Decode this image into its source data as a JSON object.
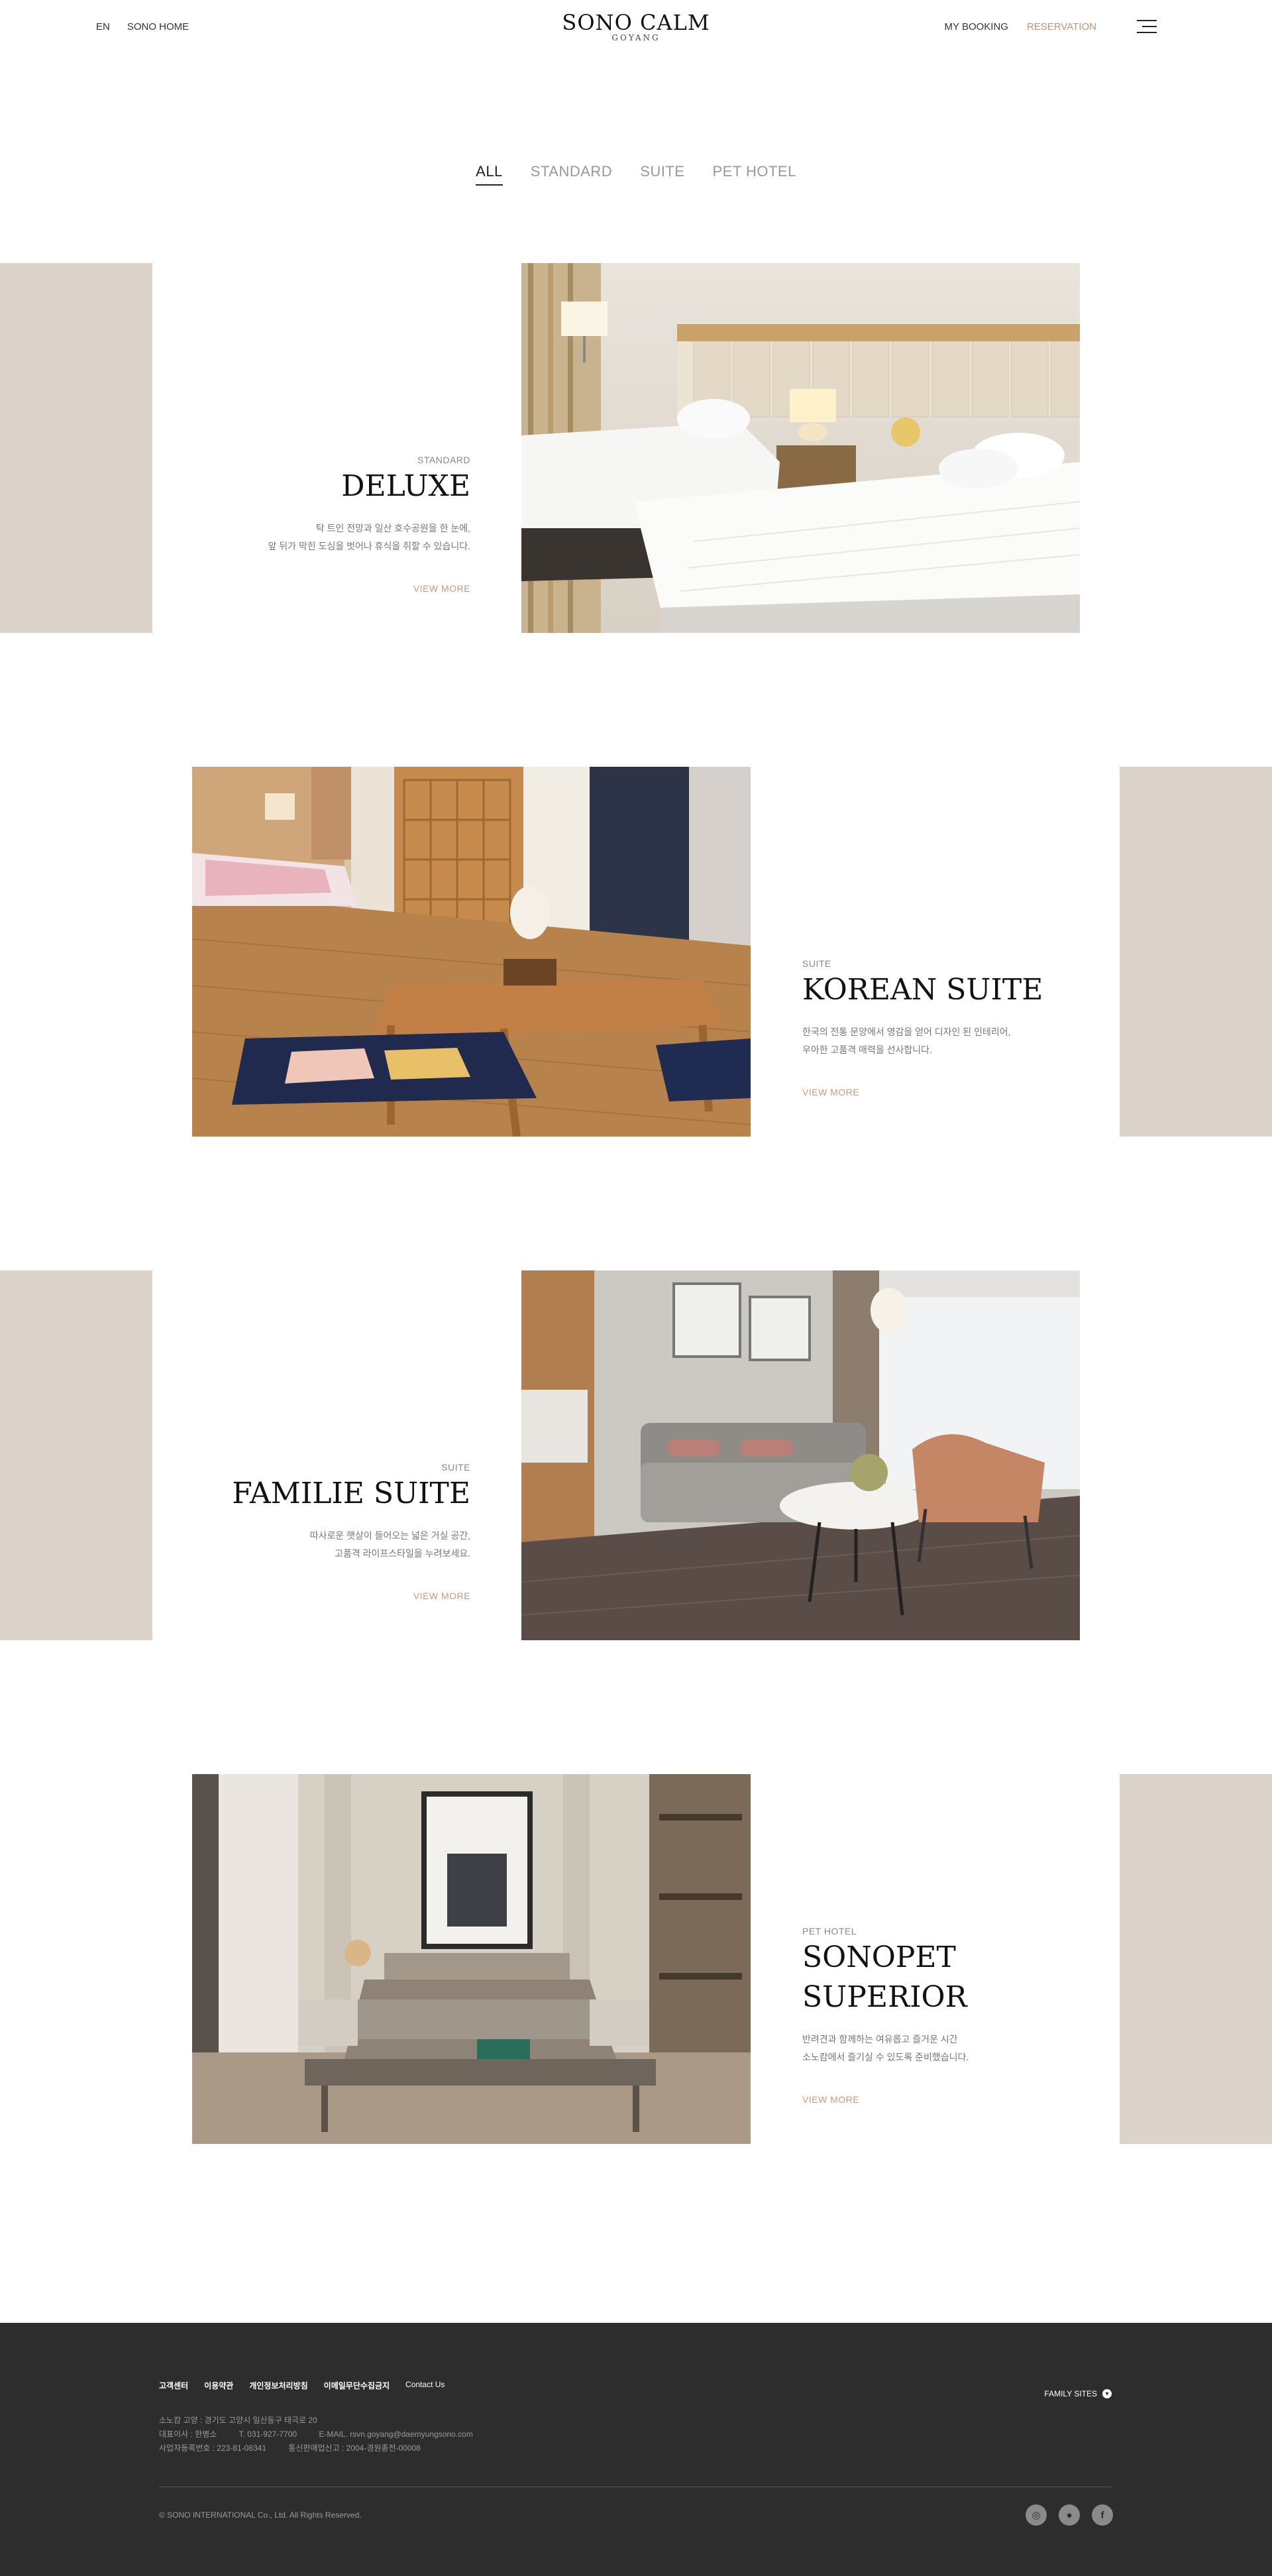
{
  "header": {
    "lang": "EN",
    "home": "SONO HOME",
    "logo_main": "SONO CALM",
    "logo_sub": "GOYANG",
    "my_booking": "MY BOOKING",
    "reservation": "RESERVATION",
    "menu_icon": "hamburger-menu-icon"
  },
  "tabs": [
    "ALL",
    "STANDARD",
    "SUITE",
    "PET HOTEL"
  ],
  "active_tab": "ALL",
  "rooms": [
    {
      "category": "STANDARD",
      "title": "DELUXE",
      "desc1": "탁 트인 전망과 일산 호수공원을 한 눈에,",
      "desc2": "앞 뒤가 막힌 도심을 벗어나 휴식을 취할 수 있습니다.",
      "more": "VIEW MORE"
    },
    {
      "category": "SUITE",
      "title": "KOREAN SUITE",
      "desc1": "한국의 전통 문양에서 영감을 얻어 디자인 된 인테리어,",
      "desc2": "우아한 고품격 매력을 선사합니다.",
      "more": "VIEW MORE"
    },
    {
      "category": "SUITE",
      "title": "FAMILIE SUITE",
      "desc1": "따사로운 햇살이 들어오는 넓은 거실 공간,",
      "desc2": "고품격 라이프스타일을 누려보세요.",
      "more": "VIEW MORE"
    },
    {
      "category": "PET HOTEL",
      "title1": "SONOPET",
      "title2": "SUPERIOR",
      "desc1": "반려견과 함께하는 여유롭고 즐거운 시간",
      "desc2": "소노캄에서 즐기실 수 있도록 준비했습니다.",
      "more": "VIEW MORE"
    }
  ],
  "footer": {
    "links": [
      "고객센터",
      "이용약관",
      "개인정보처리방침",
      "이메일무단수집금지",
      "Contact Us"
    ],
    "address": "소노캄 고양 : 경기도 고양시 일산동구 태극로 20",
    "ceo": "대표이사 : 한병소",
    "tel": "T. 031-927-7700",
    "email": "E-MAIL. rsvn.goyang@daemyungsono.com",
    "biz_no": "사업자등록번호 : 223-81-08341",
    "mail_order": "통신판매업신고 : 2004-경원종전-00008",
    "family_sites": "FAMILY SITES",
    "copyright": "© SONO INTERNATIONAL Co., Ltd. All Rights Reserved.",
    "social": [
      "instagram-icon",
      "kakaotalk-icon",
      "facebook-icon"
    ]
  },
  "colors": {
    "accent": "#c59a7d",
    "beige_block": "#dcd3ca",
    "footer_bg": "#2d2d2d"
  }
}
